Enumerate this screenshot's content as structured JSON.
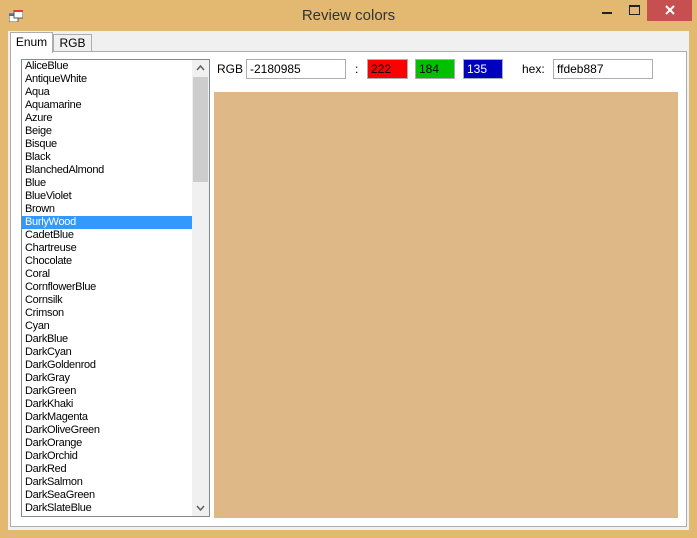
{
  "window": {
    "title": "Review colors"
  },
  "colors": {
    "titlebar": "#e3b971",
    "close_button": "#c74f50",
    "selection": "#3399ff",
    "red_field": "#ff0000",
    "green_field": "#00c000",
    "blue_field": "#0000c0",
    "preview": "#deb887"
  },
  "tabs": [
    {
      "label": "Enum",
      "selected": true
    },
    {
      "label": "RGB",
      "selected": false
    }
  ],
  "color_list": {
    "selected": "BurlyWood",
    "items": [
      "AliceBlue",
      "AntiqueWhite",
      "Aqua",
      "Aquamarine",
      "Azure",
      "Beige",
      "Bisque",
      "Black",
      "BlanchedAlmond",
      "Blue",
      "BlueViolet",
      "Brown",
      "BurlyWood",
      "CadetBlue",
      "Chartreuse",
      "Chocolate",
      "Coral",
      "CornflowerBlue",
      "Cornsilk",
      "Crimson",
      "Cyan",
      "DarkBlue",
      "DarkCyan",
      "DarkGoldenrod",
      "DarkGray",
      "DarkGreen",
      "DarkKhaki",
      "DarkMagenta",
      "DarkOliveGreen",
      "DarkOrange",
      "DarkOrchid",
      "DarkRed",
      "DarkSalmon",
      "DarkSeaGreen",
      "DarkSlateBlue"
    ]
  },
  "fields": {
    "rgb_label": "RGB",
    "rgb_value": "-2180985",
    "separator": ":",
    "red": "222",
    "green": "184",
    "blue": "135",
    "hex_label": "hex:",
    "hex_value": "ffdeb887"
  }
}
